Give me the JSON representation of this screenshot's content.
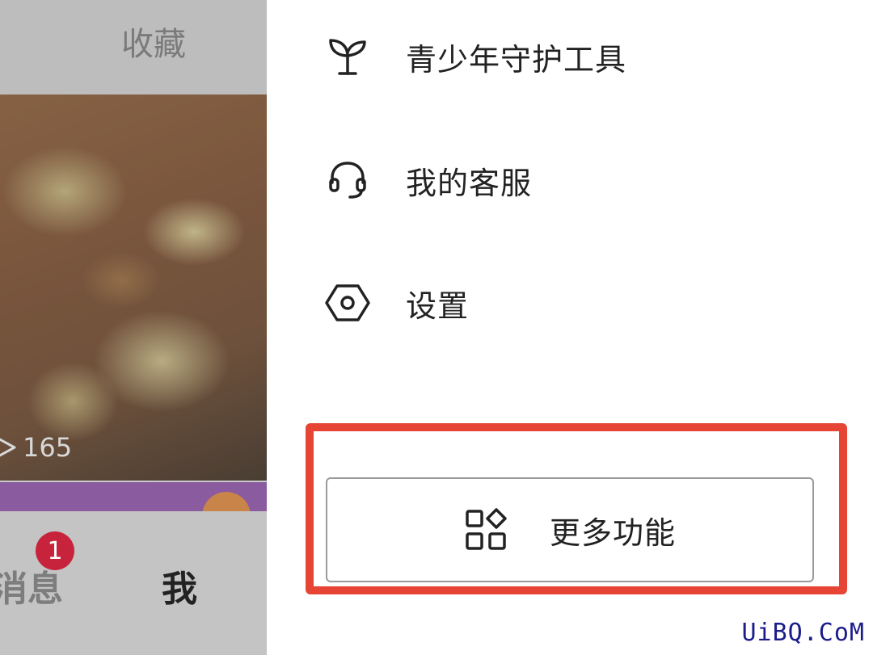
{
  "background_page": {
    "tab_favorites": "收藏",
    "view_count": "165",
    "nav_messages": "消息",
    "messages_badge": "1",
    "nav_me": "我"
  },
  "drawer": {
    "items": [
      {
        "label": "青少年守护工具",
        "icon": "sprout-icon"
      },
      {
        "label": "我的客服",
        "icon": "headset-icon"
      },
      {
        "label": "设置",
        "icon": "hexagon-gear-icon"
      }
    ],
    "more_button": {
      "label": "更多功能",
      "icon": "grid-apps-icon"
    }
  },
  "colors": {
    "highlight": "#e64536",
    "badge": "#c8233d"
  },
  "watermark": "UiBQ.CoM"
}
